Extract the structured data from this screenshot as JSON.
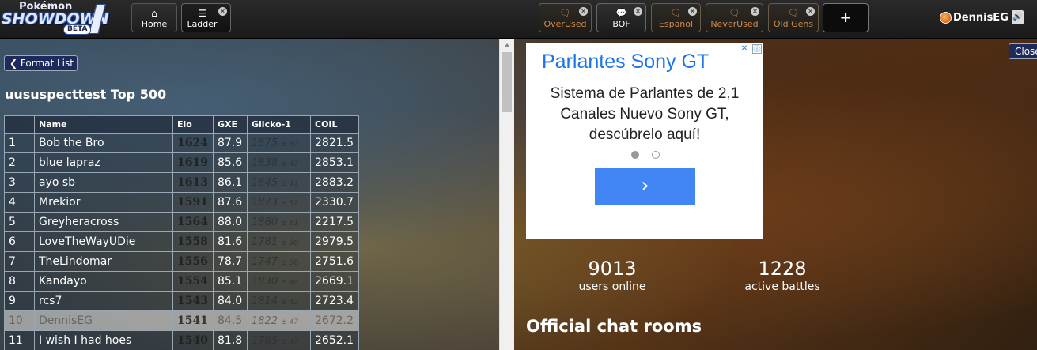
{
  "logo": {
    "line1": "Pokémon",
    "line2": "SHOWDOWN",
    "badge": "BETA"
  },
  "nav": {
    "home": {
      "icon": "⌂",
      "label": "Home"
    },
    "ladder": {
      "icon": "☰",
      "label": "Ladder",
      "close": "✕"
    }
  },
  "rooms": [
    {
      "label": "OverUsed",
      "icon": "speech-bubbles-icon"
    },
    {
      "label": "BOF",
      "icon": "speech-bubble-icon"
    },
    {
      "label": "Español",
      "icon": "speech-bubbles-icon"
    },
    {
      "label": "NeverUsed",
      "icon": "speech-bubbles-icon"
    },
    {
      "label": "Old Gens",
      "icon": "speech-bubbles-icon"
    }
  ],
  "plus_label": "+",
  "user": {
    "name": "DennisEG",
    "sound_icon": "🔊"
  },
  "ladder": {
    "back_label": "Format List",
    "title": "uususpecttest Top 500",
    "columns": [
      "",
      "Name",
      "Elo",
      "GXE",
      "Glicko-1",
      "COIL"
    ],
    "rows": [
      {
        "rank": "1",
        "name": "Bob the Bro",
        "elo": "1624",
        "gxe": "87.9",
        "glicko": "1875",
        "dev": "± 47",
        "coil": "2821.5"
      },
      {
        "rank": "2",
        "name": "blue lapraz",
        "elo": "1619",
        "gxe": "85.6",
        "glicko": "1838",
        "dev": "± 43",
        "coil": "2853.1"
      },
      {
        "rank": "3",
        "name": "ayo sb",
        "elo": "1613",
        "gxe": "86.1",
        "glicko": "1845",
        "dev": "± 41",
        "coil": "2883.2"
      },
      {
        "rank": "4",
        "name": "Mrekior",
        "elo": "1591",
        "gxe": "87.6",
        "glicko": "1873",
        "dev": "± 57",
        "coil": "2330.7"
      },
      {
        "rank": "5",
        "name": "Greyheracross",
        "elo": "1564",
        "gxe": "88.0",
        "glicko": "1880",
        "dev": "± 61",
        "coil": "2217.5"
      },
      {
        "rank": "6",
        "name": "LoveTheWayUDie",
        "elo": "1558",
        "gxe": "81.6",
        "glicko": "1781",
        "dev": "± 30",
        "coil": "2979.5"
      },
      {
        "rank": "7",
        "name": "TheLindomar",
        "elo": "1556",
        "gxe": "78.7",
        "glicko": "1747",
        "dev": "± 36",
        "coil": "2751.6"
      },
      {
        "rank": "8",
        "name": "Kandayo",
        "elo": "1554",
        "gxe": "85.1",
        "glicko": "1830",
        "dev": "± 48",
        "coil": "2669.1"
      },
      {
        "rank": "9",
        "name": "rcs7",
        "elo": "1543",
        "gxe": "84.0",
        "glicko": "1814",
        "dev": "± 43",
        "coil": "2723.4"
      },
      {
        "rank": "10",
        "name": "DennisEG",
        "elo": "1541",
        "gxe": "84.5",
        "glicko": "1822",
        "dev": "± 47",
        "coil": "2672.2"
      },
      {
        "rank": "11",
        "name": "I wish I had hoes",
        "elo": "1540",
        "gxe": "81.8",
        "glicko": "1785",
        "dev": "± 47",
        "coil": "2652.1"
      }
    ]
  },
  "ad": {
    "title": "Parlantes Sony GT",
    "body": "Sistema de Parlantes de 2,1 Canales Nuevo Sony GT, descúbrelo aquí!",
    "go_label": "›",
    "choices_icon": "ⓘ",
    "close_icon": "✕"
  },
  "stats": {
    "users": {
      "num": "9013",
      "label": "users online"
    },
    "battles": {
      "num": "1228",
      "label": "active battles"
    }
  },
  "chat_heading": "Official chat rooms",
  "close_label": "Close"
}
